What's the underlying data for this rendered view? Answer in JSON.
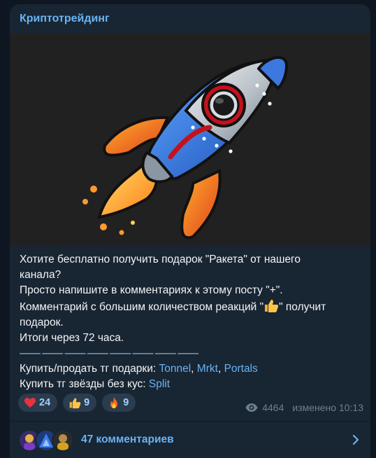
{
  "channel": {
    "name": "Криптотрейдинг"
  },
  "post": {
    "lines": {
      "l1": "Хотите бесплатно получить подарок \"Ракета\" от нашего",
      "l2": "канала?",
      "l3": "Просто напишите в комментариях к этому посту \"+\".",
      "l4a": "Комментарий с большим количеством реакций \"",
      "l4b": "\" получит",
      "l5": "подарок.",
      "l6": "Итоги через  72 часа.",
      "divider": "—— —— —— —— —— —— —— ——",
      "l8_prefix": "Купить/продать тг подарки: ",
      "l9_prefix": "Купить тг звёзды без кус: "
    },
    "links": {
      "tonnel": "Tonnel",
      "mrkt": "Mrkt",
      "portals": "Portals",
      "split": "Split",
      "comma_sep": ", "
    }
  },
  "reactions": [
    {
      "icon": "heart-icon",
      "count": "24"
    },
    {
      "icon": "thumbs-up-icon",
      "count": "9"
    },
    {
      "icon": "fire-icon",
      "count": "9"
    }
  ],
  "meta": {
    "views": "4464",
    "edited": "изменено 10:13"
  },
  "comments": {
    "label": "47 комментариев"
  },
  "colors": {
    "accent": "#6ab3f3",
    "bubble": "#182533",
    "background": "#0e1621",
    "media_bg": "#212121"
  }
}
